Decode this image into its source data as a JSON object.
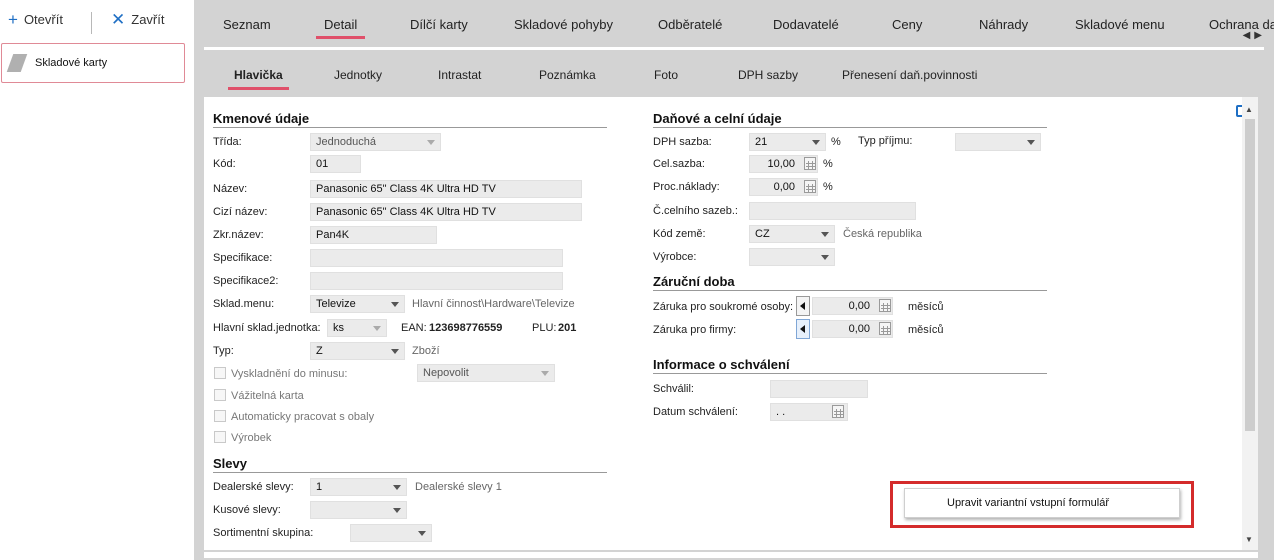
{
  "toolbar": {
    "open_label": "Otevřít",
    "close_label": "Zavřít"
  },
  "left_panel": {
    "item_label": "Skladové karty"
  },
  "main_tabs": [
    "Seznam",
    "Detail",
    "Dílčí karty",
    "Skladové pohyby",
    "Odběratelé",
    "Dodavatelé",
    "Ceny",
    "Náhrady",
    "Skladové menu",
    "Ochrana da"
  ],
  "main_tabs_active": "Detail",
  "sub_tabs": [
    "Hlavička",
    "Jednotky",
    "Intrastat",
    "Poznámka",
    "Foto",
    "DPH sazby",
    "Přenesení daň.povinnosti"
  ],
  "sub_tabs_active": "Hlavička",
  "colors": {
    "accent_underline": "#e0506a",
    "highlight_box": "#d42b2b",
    "brand_blue": "#1f6fc4"
  },
  "kmenove": {
    "title": "Kmenové údaje",
    "trida_label": "Třída:",
    "trida_value": "Jednoduchá",
    "kod_label": "Kód:",
    "kod_value": "01",
    "nazev_label": "Název:",
    "nazev_value": "Panasonic 65\" Class 4K Ultra HD TV",
    "cizi_label": "Cizí název:",
    "cizi_value": "Panasonic 65\" Class 4K Ultra HD TV",
    "zkr_label": "Zkr.název:",
    "zkr_value": "Pan4K",
    "spec_label": "Specifikace:",
    "spec_value": "",
    "spec2_label": "Specifikace2:",
    "spec2_value": "",
    "sklmenu_label": "Sklad.menu:",
    "sklmenu_value": "Televize",
    "sklmenu_hint": "Hlavní činnost\\Hardware\\Televize",
    "jednotka_label": "Hlavní sklad.jednotka:",
    "jednotka_value": "ks",
    "ean_label": "EAN:",
    "ean_value": "123698776559",
    "plu_label": "PLU:",
    "plu_value": "201",
    "typ_label": "Typ:",
    "typ_value": "Z",
    "typ_hint": "Zboží",
    "vysk_label": "Vyskladnění do minusu:",
    "vysk_value": "Nepovolit",
    "vazitelna_label": "Vážitelná karta",
    "obaly_label": "Automaticky pracovat s obaly",
    "vyrobek_label": "Výrobek"
  },
  "slevy": {
    "title": "Slevy",
    "dealer_label": "Dealerské slevy:",
    "dealer_value": "1",
    "dealer_hint": "Dealerské slevy 1",
    "kusove_label": "Kusové slevy:",
    "kusove_value": "",
    "sort_label": "Sortimentní skupina:",
    "sort_value": ""
  },
  "danove": {
    "title": "Daňové a celní údaje",
    "dph_label": "DPH sazba:",
    "dph_value": "21",
    "pct": "%",
    "typprijmu_label": "Typ příjmu:",
    "typprijmu_value": "",
    "cel_label": "Cel.sazba:",
    "cel_value": "10,00",
    "proc_label": "Proc.náklady:",
    "proc_value": "0,00",
    "celni_label": "Č.celního sazeb.:",
    "celni_value": "",
    "zeme_label": "Kód země:",
    "zeme_value": "CZ",
    "zeme_hint": "Česká republika",
    "vyrobce_label": "Výrobce:",
    "vyrobce_value": ""
  },
  "zarucni": {
    "title": "Záruční doba",
    "soukrome_label": "Záruka pro soukromé osoby:",
    "soukrome_value": "0,00",
    "soukrome_unit": "měsíců",
    "firmy_label": "Záruka pro firmy:",
    "firmy_value": "0,00",
    "firmy_unit": "měsíců"
  },
  "schvaleni": {
    "title": "Informace o schválení",
    "schvalil_label": "Schválil:",
    "schvalil_value": "",
    "datum_label": "Datum schválení:",
    "datum_value": ". ."
  },
  "popup": {
    "button_label": "Upravit variantní vstupní formulář"
  }
}
